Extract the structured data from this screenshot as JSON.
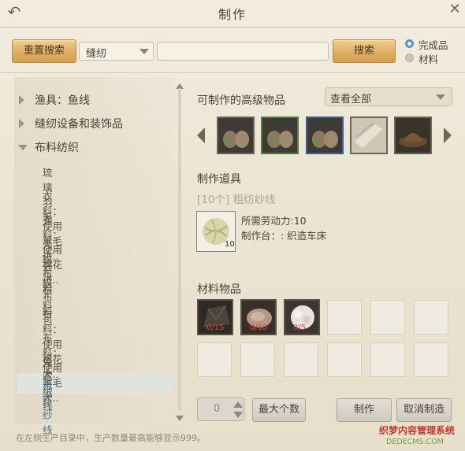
{
  "window": {
    "title": "制作"
  },
  "toolbar": {
    "reset_label": "重置搜索",
    "category_value": "缝纫",
    "search_value": "",
    "search_label": "搜索",
    "radio_finished": "完成品",
    "radio_material": "材料",
    "radio_selected": "完成品"
  },
  "tree": {
    "categories": [
      {
        "label": "渔具：鱼线",
        "expanded": false
      },
      {
        "label": "缝纫设备和装饰品",
        "expanded": false
      },
      {
        "label": "布料纺织",
        "expanded": true
      }
    ],
    "items": [
      "琉璃羽毛",
      "衣料：使用羊毛进..",
      "衣料：使用棉花进..",
      "亮纹布料",
      "云纹布料",
      "布料包",
      "布料：使用棉花大..",
      "布料：使用羊毛大..",
      "兔驼绒线",
      "粗纺纱线"
    ],
    "selected_index": 9
  },
  "advanced": {
    "heading": "可制作的高级物品",
    "filter_value": "查看全部"
  },
  "product": {
    "heading": "制作道具",
    "name": "[10个] 粗纺纱线",
    "qty": "10",
    "labor": "所需劳动力:10",
    "station": "制作台：: 织造车床"
  },
  "materials": {
    "heading": "材料物品",
    "items": [
      {
        "count": "0/15",
        "icon": "dark-fabric-icon"
      },
      {
        "count": "0/10",
        "icon": "fur-pelt-icon"
      },
      {
        "count": "0/5",
        "icon": "cotton-ball-icon"
      }
    ]
  },
  "craft": {
    "quantity": "0",
    "max_label": "最大个数",
    "make_label": "制作",
    "cancel_label": "取消制造"
  },
  "footer": {
    "note": "在左侧生产目录中，生产数量最高能够显示999。"
  },
  "watermark": {
    "line1": "织梦内容管理系统",
    "line2": "DEDECMS.COM"
  },
  "colors": {
    "gold_button": "#dfae62",
    "product_name": "#b2a88f",
    "material_count": "#d4493f",
    "selected_row": "#e1e3de",
    "radio_on": "#5b8fcf"
  }
}
